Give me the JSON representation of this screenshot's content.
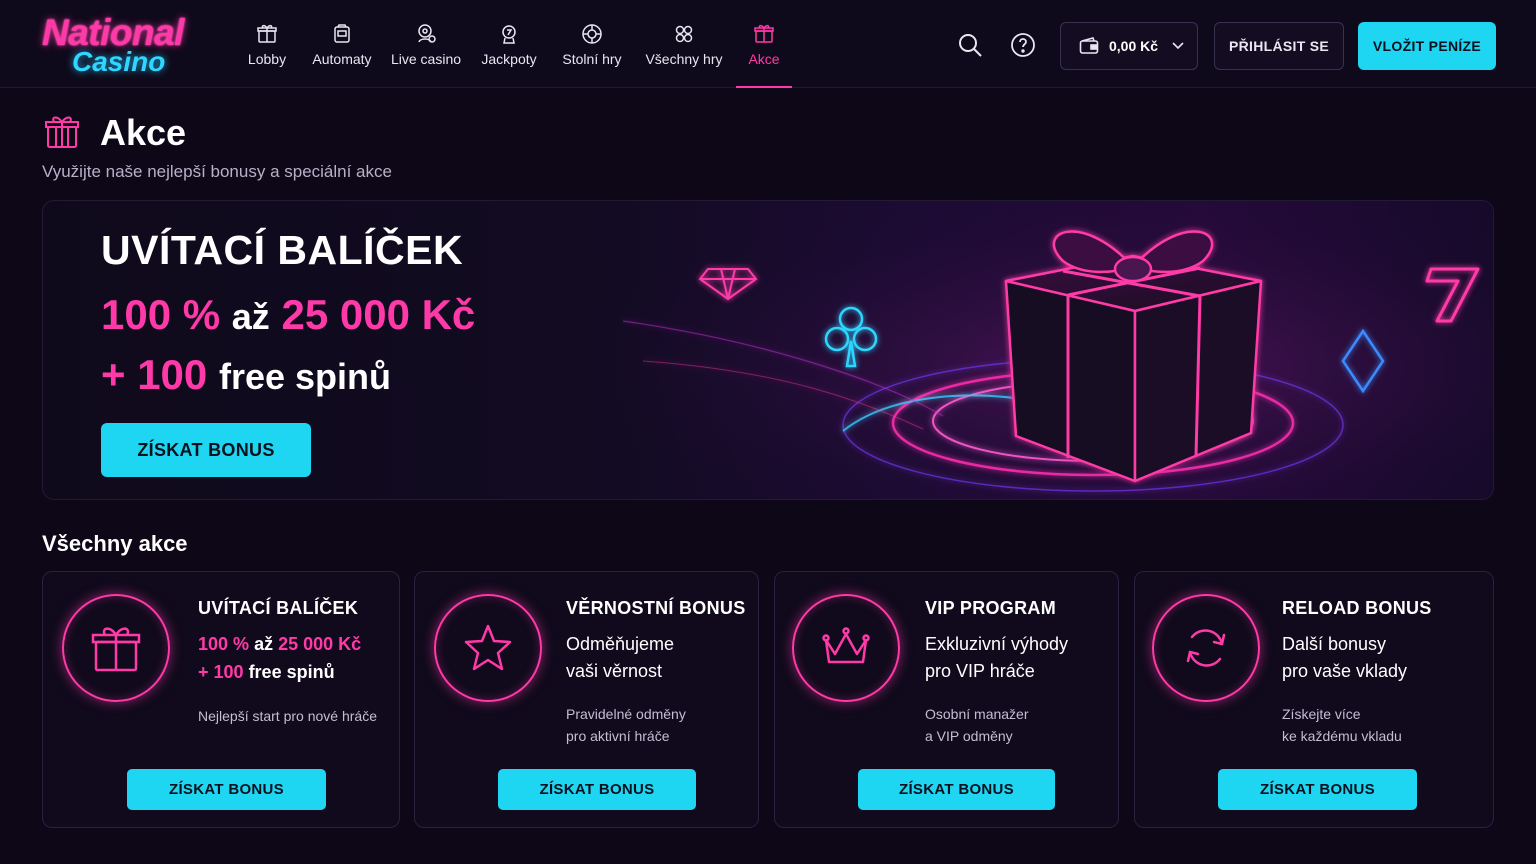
{
  "header": {
    "logo": {
      "line1": "National",
      "line2": "Casino"
    },
    "nav": [
      {
        "label": "Lobby",
        "icon": "gift-box-icon"
      },
      {
        "label": "Automaty",
        "icon": "slot-machine-icon"
      },
      {
        "label": "Live casino",
        "icon": "live-dealer-icon"
      },
      {
        "label": "Jackpoty",
        "icon": "jackpot-icon"
      },
      {
        "label": "Stolní hry",
        "icon": "chip-icon"
      },
      {
        "label": "Všechny hry",
        "icon": "grid-icon"
      },
      {
        "label": "Akce",
        "icon": "gift-icon",
        "active": true
      }
    ],
    "balance": "0,00 Kč",
    "login_label": "PŘIHLÁSIT SE",
    "deposit_label": "VLOŽIT PENÍZE"
  },
  "page": {
    "title": "Akce",
    "subtitle": "Využijte naše nejlepší bonusy a speciální akce"
  },
  "hero": {
    "heading": "UVÍTACÍ BALÍČEK",
    "line1": {
      "a": "100 %",
      "b": "až",
      "c": "25 000 Kč"
    },
    "line2": {
      "a": "+ 100",
      "b": "free spinů"
    },
    "button": "ZÍSKAT BONUS"
  },
  "section_title": "Všechny akce",
  "cards": [
    {
      "title": "UVÍTACÍ BALÍČEK",
      "line1": {
        "a": "100 %",
        "b": "až",
        "c": "25 000 Kč"
      },
      "line2": {
        "a": "+ 100",
        "b": "free spinů"
      },
      "desc1": "Nejlepší start pro nové hráče",
      "desc2": "",
      "button": "ZÍSKAT BONUS",
      "icon": "gift-icon"
    },
    {
      "title": "VĚRNOSTNÍ BONUS",
      "line1": "Odměňujeme",
      "line2": "vaši věrnost",
      "desc1": "Pravidelné odměny",
      "desc2": "pro aktivní hráče",
      "button": "ZÍSKAT BONUS",
      "icon": "star-icon"
    },
    {
      "title": "VIP PROGRAM",
      "line1": "Exkluzivní výhody",
      "line2": "pro VIP hráče",
      "desc1": "Osobní manažer",
      "desc2": "a VIP odměny",
      "button": "ZÍSKAT BONUS",
      "icon": "crown-icon"
    },
    {
      "title": "RELOAD BONUS",
      "line1": "Další bonusy",
      "line2": "pro vaše vklady",
      "desc1": "Získejte více",
      "desc2": "ke každému vkladu",
      "button": "ZÍSKAT BONUS",
      "icon": "reload-icon"
    }
  ],
  "colors": {
    "accent_pink": "#ff3aa8",
    "accent_cyan": "#1fd6f2",
    "background": "#0d0717"
  }
}
